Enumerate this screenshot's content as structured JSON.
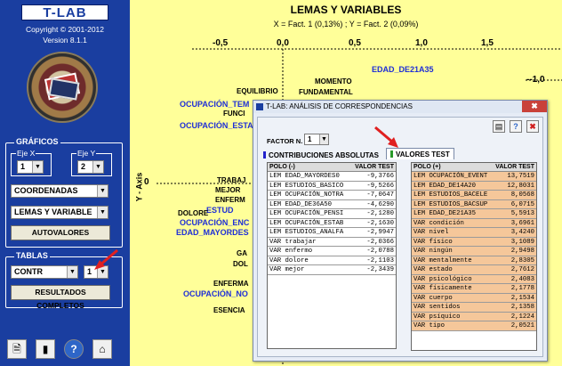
{
  "app": {
    "logo": "T-LAB",
    "copyright": "Copyright © 2001-2012",
    "version": "Version 8.1.1"
  },
  "sidebar": {
    "graphs_title": "GRÁFICOS",
    "axis_x_label": "Eje X",
    "axis_x_value": "1",
    "axis_y_label": "Eje Y",
    "axis_y_value": "2",
    "coord_select": "COORDENADAS",
    "display_select": "LEMAS Y VARIABLE",
    "eigen_button": "AUTOVALORES",
    "tables_title": "TABLAS",
    "table_select": "CONTR",
    "table_index": "1",
    "results_button": "RESULTADOS COMPLETOS"
  },
  "plot": {
    "title": "LEMAS Y VARIABLES",
    "subtitle": "X = Fact. 1 (0,13%) ; Y = Fact. 2 (0,09%)",
    "y_axis_label": "Y - Axis",
    "x_ticks": [
      "-0,5",
      "0,0",
      "0,5",
      "1,0",
      "1,5"
    ],
    "y_ticks": [
      "--1,0",
      "0"
    ],
    "blue_points": [
      "EDAD_DE21A35",
      "OCUPACIÓN_TEM",
      "OCUPACIÓN_ESTA",
      "ESTUD",
      "OCUPACIÓN_ENC",
      "EDAD_MAYORDES",
      "OCUPACIÓN_NO"
    ],
    "black_points": [
      "MOMENTO",
      "EQUILIBRIO",
      "FUNDAMENTAL",
      "FUNCI",
      "TRABAJ",
      "MEJOR",
      "ENFERM",
      "DOLORE",
      "GA",
      "DOL",
      "ENFERMA",
      "ESENCIA"
    ]
  },
  "dialog": {
    "title": "T-LAB: ANÁLISIS DE CORRESPONDENCIAS",
    "close": "✖",
    "factor_label": "FACTOR N.",
    "factor_value": "1",
    "tab_contrib": "CONTRIBUCIONES ABSOLUTAS",
    "tab_values": "VALORES TEST",
    "neg_table": {
      "col1": "POLO (-)",
      "col2": "VALOR TEST",
      "rows": [
        [
          "LEM EDAD_MAYORDES0",
          "-9,3766"
        ],
        [
          "LEM ESTUDIOS_BASICO",
          "-9,5266"
        ],
        [
          "LEM OCUPACIÓN_NOTRA",
          "-7,0647"
        ],
        [
          "LEM EDAD_DE36A50",
          "-4,6290"
        ],
        [
          "LEM OCUPACIÓN_PENSI",
          "-2,1280"
        ],
        [
          "LEM OCUPACIÓN_ESTAB",
          "-2,1630"
        ],
        [
          "LEM ESTUDIOS_ANALFA",
          "-2,9947"
        ],
        [
          "VAR trabajar",
          "-2,0366"
        ],
        [
          "VAR enfermo",
          "-2,0788"
        ],
        [
          "VAR dolore",
          "-2,1103"
        ],
        [
          "VAR mejor",
          "-2,3439"
        ]
      ]
    },
    "pos_table": {
      "col1": "POLO (+)",
      "col2": "VALOR TEST",
      "rows": [
        [
          "LEM OCUPACIÓN_EVENT",
          "13,7519"
        ],
        [
          "LEM EDAD_DE14A20",
          "12,8031"
        ],
        [
          "LEM ESTUDIOS_BACELE",
          "8,0568"
        ],
        [
          "LEM ESTUDIOS_BACSUP",
          "6,0715"
        ],
        [
          "LEM EDAD_DE21A35",
          "5,5913"
        ],
        [
          "VAR condición",
          "3,6961"
        ],
        [
          "VAR nivel",
          "3,4240"
        ],
        [
          "VAR físico",
          "3,1089"
        ],
        [
          "VAR ningún",
          "2,9498"
        ],
        [
          "VAR mentalmente",
          "2,8305"
        ],
        [
          "VAR estado",
          "2,7612"
        ],
        [
          "VAR psicológico",
          "2,4083"
        ],
        [
          "VAR físicamente",
          "2,1778"
        ],
        [
          "VAR cuerpo",
          "2,1534"
        ],
        [
          "VAR sentidos",
          "2,1358"
        ],
        [
          "VAR psíquico",
          "2,1224"
        ],
        [
          "VAR tipo",
          "2,0521"
        ]
      ]
    }
  },
  "colors": {
    "sidebar": "#1a3ea0",
    "plot_bg": "#ffff99",
    "blue_point": "#1f2fd6",
    "positive_row": "#f5c79a",
    "arrow": "#e02020"
  }
}
